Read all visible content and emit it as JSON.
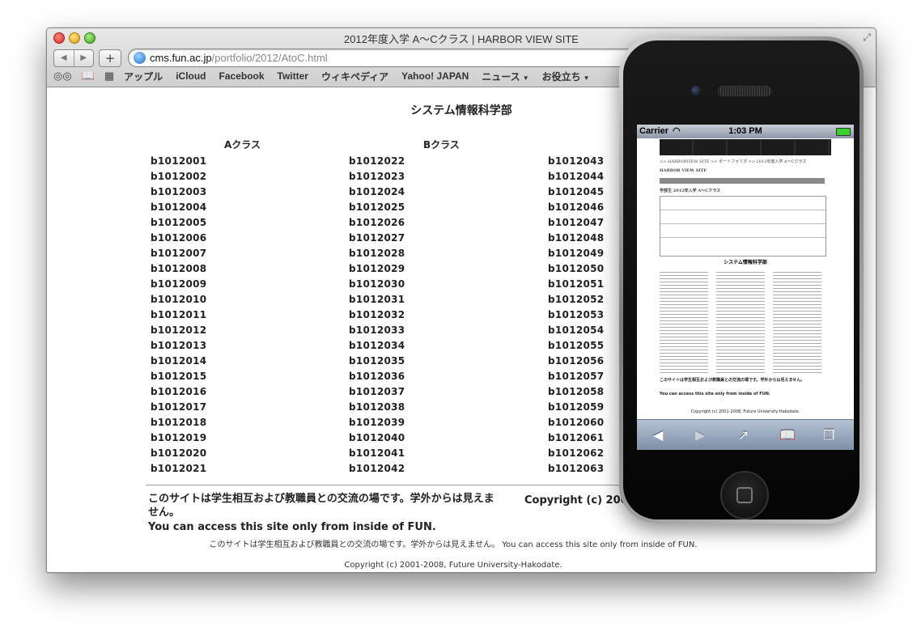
{
  "window": {
    "title": "2012年度入学 A〜Cクラス | HARBOR VIEW SITE",
    "fullscreen_icon": "⤢"
  },
  "toolbar": {
    "back": "◀",
    "forward": "▶",
    "add": "+",
    "url_host": "cms.fun.ac.jp",
    "url_path": "/portfolio/2012/AtoC.html"
  },
  "bookmarks_bar": {
    "reading_list_icon": "◎◎",
    "bookmarks_icon": "📖",
    "top_sites_icon": "▦",
    "items": [
      "アップル",
      "iCloud",
      "Facebook",
      "Twitter",
      "ウィキペディア",
      "Yahoo! JAPAN"
    ],
    "menus": [
      "ニュース",
      "お役立ち"
    ],
    "menu_arrow": "▼"
  },
  "page": {
    "department": "システム情報科学部",
    "class_a_header": "Aクラス",
    "class_b_header": "Bクラス",
    "class_a_ids": [
      "b1012001",
      "b1012002",
      "b1012003",
      "b1012004",
      "b1012005",
      "b1012006",
      "b1012007",
      "b1012008",
      "b1012009",
      "b1012010",
      "b1012011",
      "b1012012",
      "b1012013",
      "b1012014",
      "b1012015",
      "b1012016",
      "b1012017",
      "b1012018",
      "b1012019",
      "b1012020",
      "b1012021"
    ],
    "class_b_ids": [
      "b1012022",
      "b1012023",
      "b1012024",
      "b1012025",
      "b1012026",
      "b1012027",
      "b1012028",
      "b1012029",
      "b1012030",
      "b1012031",
      "b1012032",
      "b1012033",
      "b1012034",
      "b1012035",
      "b1012036",
      "b1012037",
      "b1012038",
      "b1012039",
      "b1012040",
      "b1012041",
      "b1012042"
    ],
    "class_c_ids": [
      "b1012043",
      "b1012044",
      "b1012045",
      "b1012046",
      "b1012047",
      "b1012048",
      "b1012049",
      "b1012050",
      "b1012051",
      "b1012052",
      "b1012053",
      "b1012054",
      "b1012055",
      "b1012056",
      "b1012057",
      "b1012058",
      "b1012059",
      "b1012060",
      "b1012061",
      "b1012062",
      "b1012063"
    ],
    "footer_notice_jp": "このサイトは学生相互および教職員との交流の場です。学外からは見えません。",
    "footer_notice_en": "You can access this site only from inside of FUN.",
    "footer_copyright_partial": "Copyright (c) 2001-2008, Future University-Hakodate.",
    "footer_line": "このサイトは学生相互および教職員との交流の場です。学外からは見えません。 You can access this site only from inside of FUN.",
    "footer_copyright": "Copyright (c) 2001-2008, Future University-Hakodate."
  },
  "phone": {
    "carrier": "Carrier",
    "time": "1:03 PM",
    "wifi_icon": "◠",
    "breadcrumb": ">> HARBORVIEW SITE >> ポートフォリオ >> 2012年度入学 A〜Cクラス",
    "site_title": "HARBOR VIEW SITE",
    "year_row": "学部生  2012年入学  A〜Cクラス",
    "department": "システム情報科学部",
    "footer_jp": "このサイトは学生相互および教職員との交流の場です。学外からは見えません。",
    "footer_en": "You can access this site only from inside of FUN.",
    "footer_copy": "Copyright (c) 2001-2008, Future University-Hakodate.",
    "toolbar_back": "◀",
    "toolbar_forward": "▶",
    "toolbar_share": "↗",
    "toolbar_bookmarks": "📖",
    "toolbar_tabs": "❐"
  }
}
